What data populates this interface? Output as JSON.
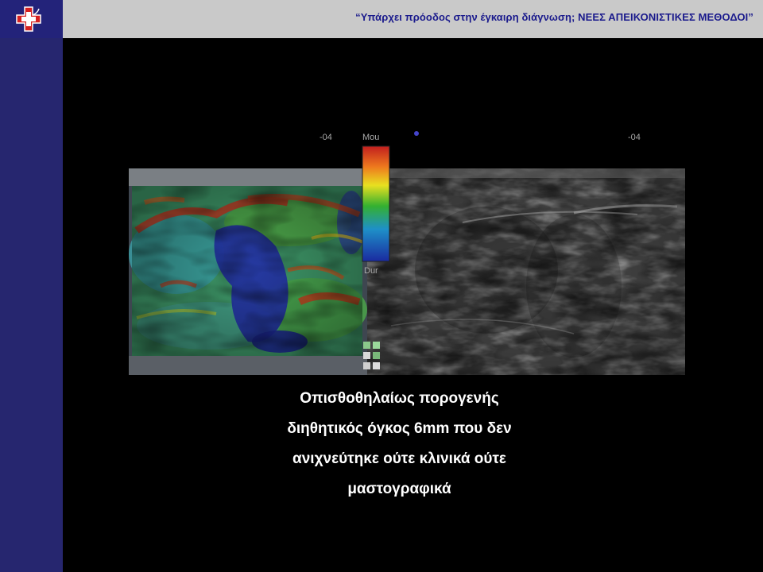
{
  "header": {
    "title": "“Υπάρχει πρόοδος στην έγκαιρη διάγνωση;  ΝΕΕΣ ΑΠΕΙΚΟΝΙΣΤΙΚΕΣ  ΜΕΘΟΔΟΙ”"
  },
  "logo": {
    "icon": "medical-cross-logo"
  },
  "figure": {
    "left_marker": "-04",
    "right_marker": "-04",
    "scale_top": "Mou",
    "scale_bottom": "Dur"
  },
  "caption": {
    "lines": [
      "Οπισθοθηλαίως πορογενής",
      "διηθητικός όγκος 6mm που δεν",
      "ανιχνεύτηκε ούτε κλινικά ούτε",
      "μαστογραφικά"
    ]
  },
  "colors": {
    "header_bg": "#c9c9c9",
    "title_text": "#1a1a8c",
    "sidebar_bg": "#26266f",
    "logo_bg": "#23237a",
    "slide_bg": "#000000",
    "caption_text": "#ffffff"
  }
}
